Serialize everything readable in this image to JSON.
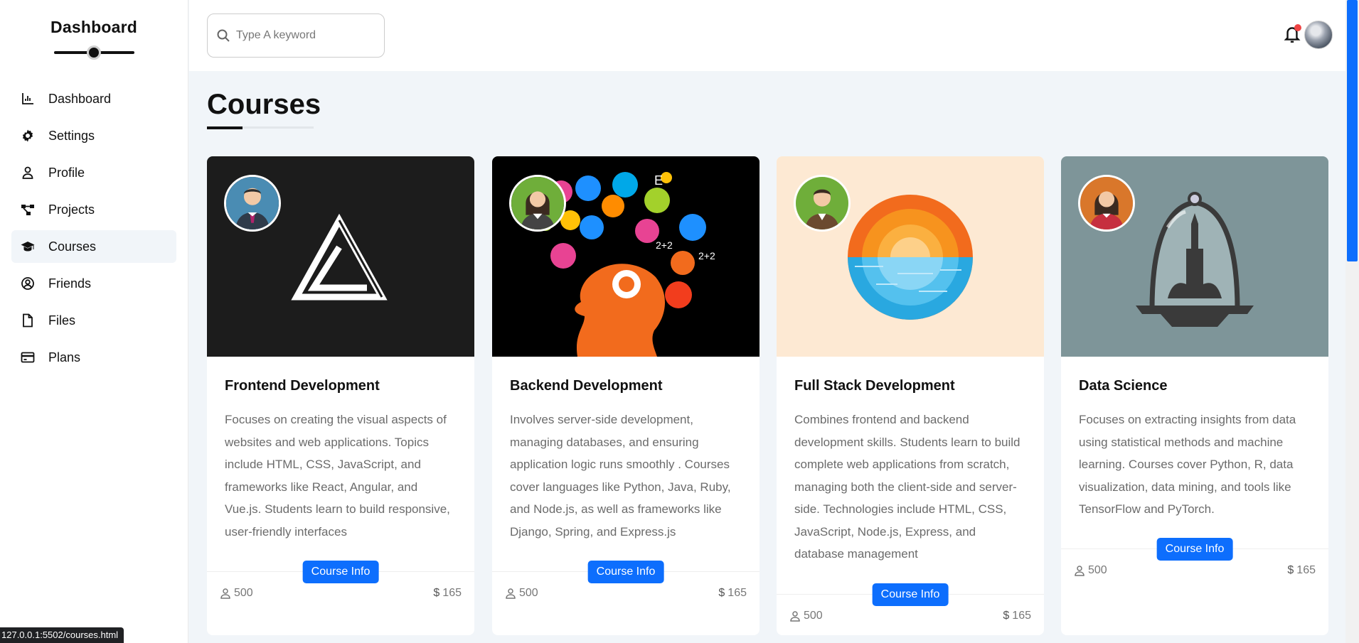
{
  "sidebar": {
    "title": "Dashboard",
    "items": [
      {
        "label": "Dashboard",
        "icon": "chart-line-icon"
      },
      {
        "label": "Settings",
        "icon": "gear-icon"
      },
      {
        "label": "Profile",
        "icon": "user-icon"
      },
      {
        "label": "Projects",
        "icon": "diagram-project-icon"
      },
      {
        "label": "Courses",
        "icon": "graduation-cap-icon",
        "active": true
      },
      {
        "label": "Friends",
        "icon": "circle-user-icon"
      },
      {
        "label": "Files",
        "icon": "file-icon"
      },
      {
        "label": "Plans",
        "icon": "credit-card-icon"
      }
    ]
  },
  "header": {
    "search_placeholder": "Type A keyword",
    "notification_icon": "bell-icon",
    "notification_dot_color": "#ef4444"
  },
  "main": {
    "page_title": "Courses"
  },
  "courses": [
    {
      "title": "Frontend Development",
      "description": "Focuses on creating the visual aspects of websites and web applications. Topics include HTML, CSS, JavaScript, and frameworks like React, Angular, and Vue.js. Students learn to build responsive, user-friendly interfaces",
      "button_label": "Course Info",
      "students": "500",
      "price": "165"
    },
    {
      "title": "Backend Development",
      "description": "Involves server-side development, managing databases, and ensuring application logic runs smoothly . Courses cover languages like Python, Java, Ruby, and Node.js, as well as frameworks like Django, Spring, and Express.js",
      "button_label": "Course Info",
      "students": "500",
      "price": "165"
    },
    {
      "title": "Full Stack Development",
      "description": "Combines frontend and backend development skills. Students learn to build complete web applications from scratch, managing both the client-side and server-side. Technologies include HTML, CSS, JavaScript, Node.js, Express, and database management",
      "button_label": "Course Info",
      "students": "500",
      "price": "165"
    },
    {
      "title": "Data Science",
      "description": "Focuses on extracting insights from data using statistical methods and machine learning. Courses cover Python, R, data visualization, data mining, and tools like TensorFlow and PyTorch.",
      "button_label": "Course Info",
      "students": "500",
      "price": "165"
    }
  ],
  "status_bar": {
    "url": "127.0.0.1:5502/courses.html"
  },
  "colors": {
    "accent": "#0d6efd",
    "page_bg": "#f1f5f9"
  }
}
